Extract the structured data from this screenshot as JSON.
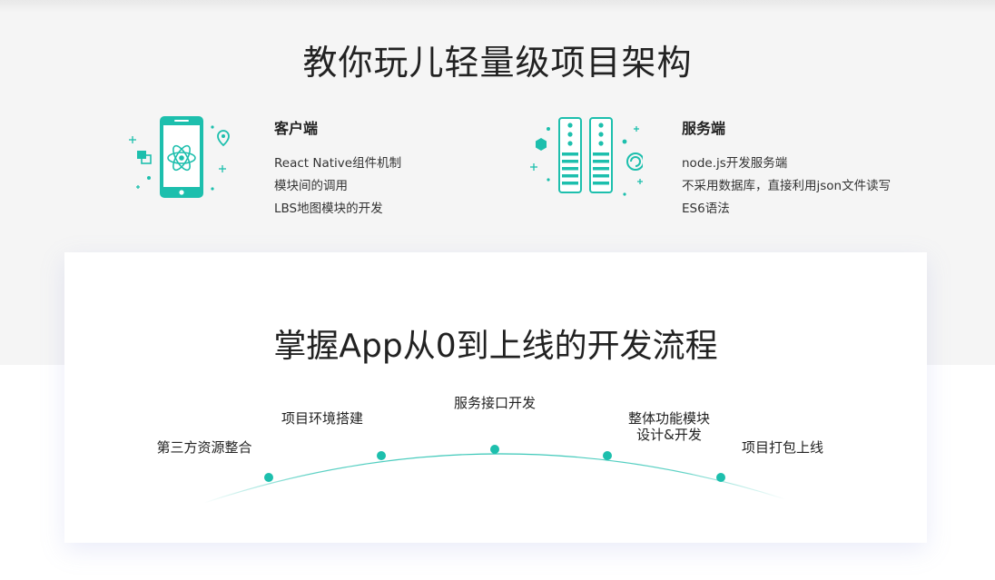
{
  "architecture": {
    "title": "教你玩儿轻量级项目架构",
    "client": {
      "heading": "客户端",
      "items": [
        "React Native组件机制",
        "模块间的调用",
        "LBS地图模块的开发"
      ]
    },
    "server": {
      "heading": "服务端",
      "items": [
        "node.js开发服务端",
        "不采用数据库，直接利用json文件读写",
        "ES6语法"
      ]
    }
  },
  "process": {
    "title": "掌握App从0到上线的开发流程",
    "steps": [
      {
        "line1": "第三方资源整合",
        "line2": ""
      },
      {
        "line1": "项目环境搭建",
        "line2": ""
      },
      {
        "line1": "服务接口开发",
        "line2": ""
      },
      {
        "line1": "整体功能模块",
        "line2": "设计&开发"
      },
      {
        "line1": "项目打包上线",
        "line2": ""
      }
    ]
  },
  "colors": {
    "accent": "#1dbfad",
    "top_background": "#f5f5f5",
    "card_background": "#ffffff"
  },
  "icons": {
    "client": "mobile-phone-react-icon",
    "server": "server-racks-icon"
  }
}
